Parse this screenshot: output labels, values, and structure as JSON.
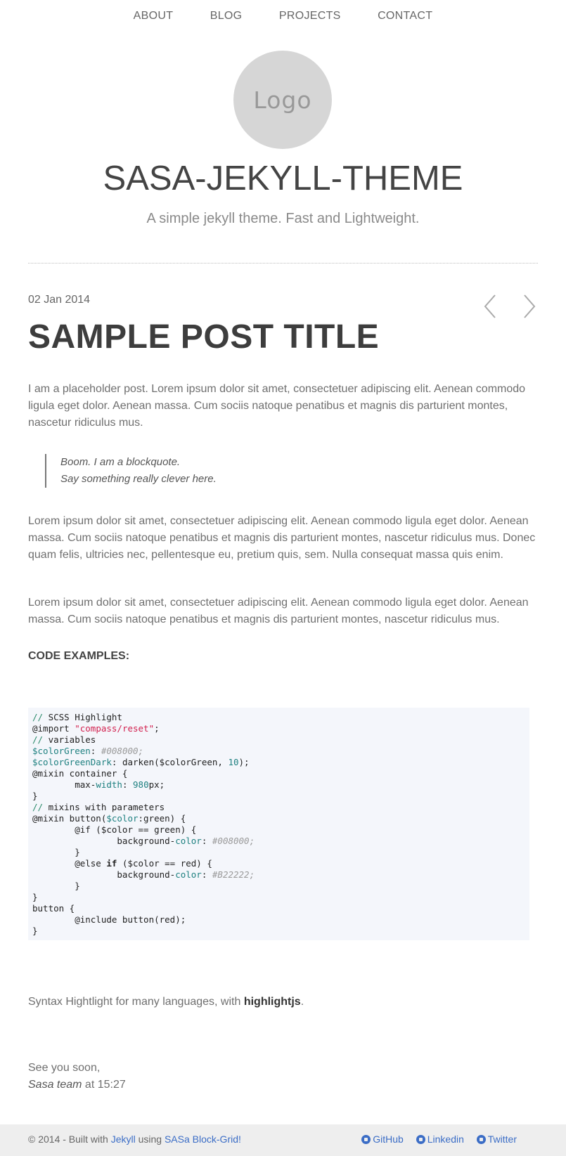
{
  "nav": {
    "items": [
      "ABOUT",
      "BLOG",
      "PROJECTS",
      "CONTACT"
    ]
  },
  "header": {
    "logo_text": "Logo",
    "title": "SASA-JEKYLL-THEME",
    "subtitle": "A simple jekyll theme. Fast and Lightweight."
  },
  "post": {
    "date": "02 Jan 2014",
    "title": "SAMPLE POST TITLE",
    "prev_icon": "chevron-left-icon",
    "next_icon": "chevron-right-icon",
    "intro": "I am a placeholder post. Lorem ipsum dolor sit amet, consectetuer adipiscing elit. Aenean commodo ligula eget dolor. Aenean massa. Cum sociis natoque penatibus et magnis dis parturient montes, nascetur ridiculus mus.",
    "blockquote": [
      "Boom. I am a blockquote.",
      "Say something really clever here."
    ],
    "para2": "Lorem ipsum dolor sit amet, consectetuer adipiscing elit. Aenean commodo ligula eget dolor. Aenean massa. Cum sociis natoque penatibus et magnis dis parturient montes, nascetur ridiculus mus. Donec quam felis, ultricies nec, pellentesque eu, pretium quis, sem. Nulla consequat massa quis enim.",
    "para3": "Lorem ipsum dolor sit amet, consectetuer adipiscing elit. Aenean commodo ligula eget dolor. Aenean massa. Cum sociis natoque penatibus et magnis dis parturient montes, nascetur ridiculus mus.",
    "code_heading": "CODE EXAMPLES:",
    "code_lines": [
      [
        [
          "c-cm",
          "// "
        ],
        [
          "",
          "SCSS Highlight"
        ]
      ],
      [
        [
          "",
          "@import "
        ],
        [
          "c-str",
          "\"compass/reset\""
        ],
        [
          "",
          ";"
        ]
      ],
      [
        [
          "c-cm",
          "// "
        ],
        [
          "",
          "variables"
        ]
      ],
      [
        [
          "c-var",
          "$colorGreen"
        ],
        [
          "",
          ": "
        ],
        [
          "c-it",
          "#008000;"
        ]
      ],
      [
        [
          "c-var",
          "$colorGreenDark"
        ],
        [
          "",
          ": darken($colorGreen, "
        ],
        [
          "c-num",
          "10"
        ],
        [
          "",
          ");"
        ]
      ],
      [
        [
          "",
          "@mixin container {"
        ]
      ],
      [
        [
          "",
          "        max-"
        ],
        [
          "c-attr",
          "width"
        ],
        [
          "",
          ": "
        ],
        [
          "c-num",
          "980"
        ],
        [
          "",
          "px;"
        ]
      ],
      [
        [
          "",
          "}"
        ]
      ],
      [
        [
          "c-cm",
          "// "
        ],
        [
          "",
          "mixins with parameters"
        ]
      ],
      [
        [
          "",
          "@mixin button("
        ],
        [
          "c-var",
          "$color"
        ],
        [
          "",
          ":green) {"
        ]
      ],
      [
        [
          "",
          "        @if ($color == green) {"
        ]
      ],
      [
        [
          "",
          "                background-"
        ],
        [
          "c-attr",
          "color"
        ],
        [
          "",
          ": "
        ],
        [
          "c-it",
          "#008000;"
        ]
      ],
      [
        [
          "",
          "        }"
        ]
      ],
      [
        [
          "",
          "        @else "
        ],
        [
          "c-kw",
          "if"
        ],
        [
          "",
          " ($color == red) {"
        ]
      ],
      [
        [
          "",
          "                background-"
        ],
        [
          "c-attr",
          "color"
        ],
        [
          "",
          ": "
        ],
        [
          "c-it",
          "#B22222;"
        ]
      ],
      [
        [
          "",
          "        }"
        ]
      ],
      [
        [
          "",
          "}"
        ]
      ],
      [
        [
          "",
          "button {"
        ]
      ],
      [
        [
          "",
          "        @include button(red);"
        ]
      ],
      [
        [
          "",
          "}"
        ]
      ]
    ],
    "syntax_prefix": "Syntax Hightlight for many languages, with ",
    "syntax_link": "highlightjs",
    "syntax_suffix": ".",
    "signoff_line1": "See you soon,",
    "signoff_author": "Sasa team",
    "signoff_time": " at 15:27"
  },
  "footer": {
    "copy_prefix": "© 2014 - Built with ",
    "jekyll_link": "Jekyll",
    "copy_mid": " using ",
    "grid_link": "SASa Block-Grid!",
    "social": [
      {
        "label": "GitHub",
        "icon": "github-icon"
      },
      {
        "label": "Linkedin",
        "icon": "linkedin-icon"
      },
      {
        "label": "Twitter",
        "icon": "twitter-icon"
      }
    ]
  },
  "colors": {
    "accent_link": "#3b6dc6",
    "code_bg": "#f4f6fb",
    "footer_bg": "#eeeeee"
  }
}
